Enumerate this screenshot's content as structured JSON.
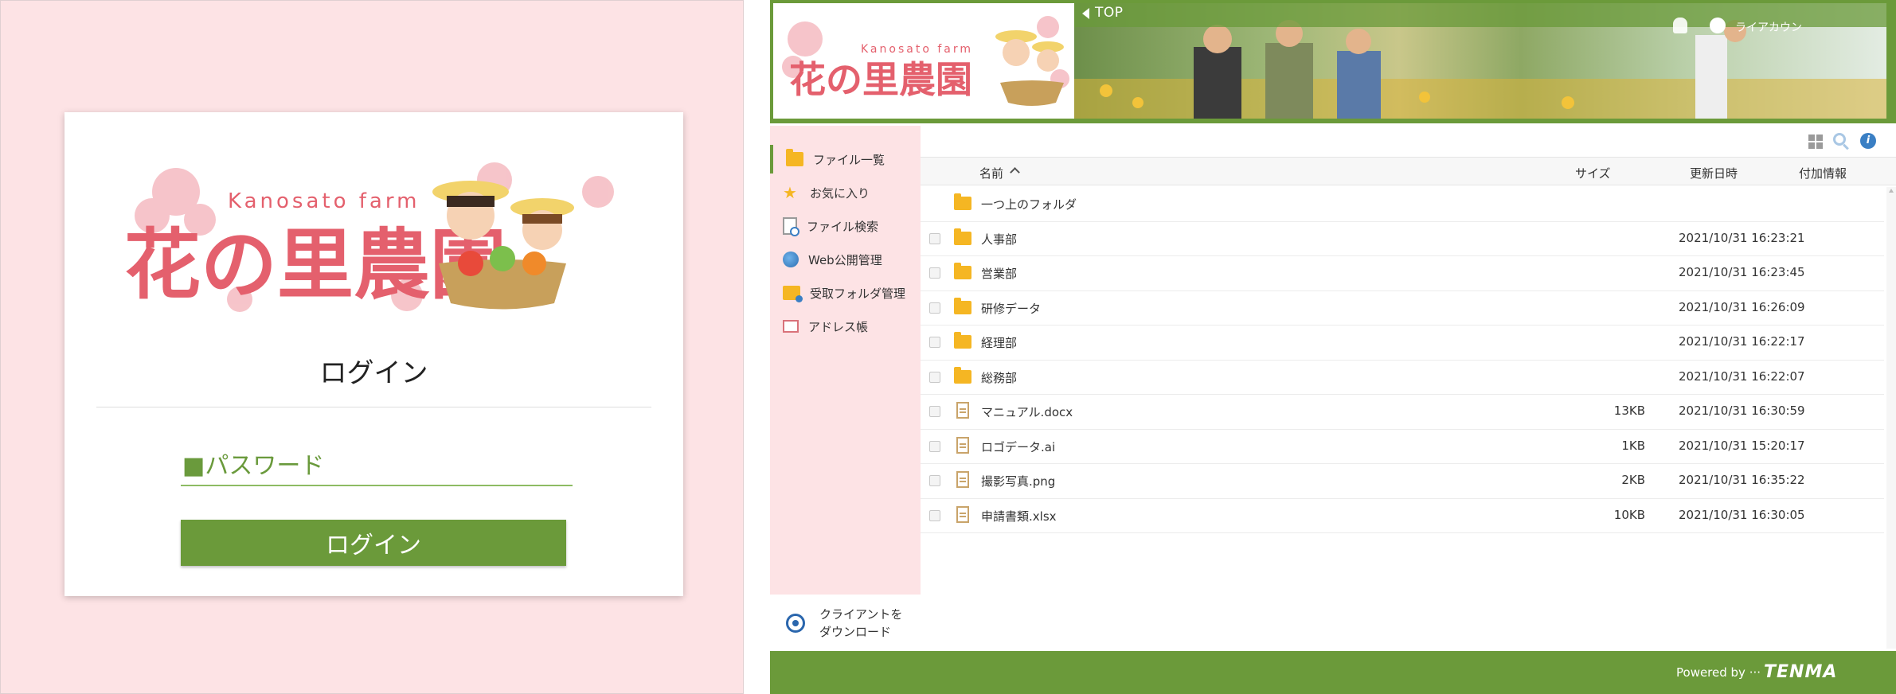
{
  "login": {
    "logo_text_en": "Kanosato farm",
    "logo_text_jp": "花の里農園",
    "title": "ログイン",
    "password_placeholder": "■パスワード",
    "login_button": "ログイン"
  },
  "header": {
    "logo_text_en": "Kanosato farm",
    "logo_text_jp": "花の里農園",
    "top_link": "TOP",
    "user_name": "ライアカウン"
  },
  "sidebar": {
    "items": [
      {
        "label": "ファイル一覧",
        "icon": "folder-icon"
      },
      {
        "label": "お気に入り",
        "icon": "star-icon"
      },
      {
        "label": "ファイル検索",
        "icon": "file-search-icon"
      },
      {
        "label": "Web公開管理",
        "icon": "globe-icon"
      },
      {
        "label": "受取フォルダ管理",
        "icon": "inbox-folder-icon"
      },
      {
        "label": "アドレス帳",
        "icon": "address-book-icon"
      }
    ],
    "client_download": "クライアントを\nダウンロード"
  },
  "table": {
    "columns": {
      "name": "名前",
      "size": "サイズ",
      "date": "更新日時",
      "extra": "付加情報"
    },
    "rows": [
      {
        "type": "parent",
        "name": "一つ上のフォルダ",
        "size": "",
        "date": ""
      },
      {
        "type": "folder",
        "name": "人事部",
        "size": "",
        "date": "2021/10/31 16:23:21"
      },
      {
        "type": "folder",
        "name": "営業部",
        "size": "",
        "date": "2021/10/31 16:23:45"
      },
      {
        "type": "folder",
        "name": "研修データ",
        "size": "",
        "date": "2021/10/31 16:26:09"
      },
      {
        "type": "folder",
        "name": "経理部",
        "size": "",
        "date": "2021/10/31 16:22:17"
      },
      {
        "type": "folder",
        "name": "総務部",
        "size": "",
        "date": "2021/10/31 16:22:07"
      },
      {
        "type": "file",
        "name": "マニュアル.docx",
        "size": "13KB",
        "date": "2021/10/31 16:30:59"
      },
      {
        "type": "file",
        "name": "ロゴデータ.ai",
        "size": "1KB",
        "date": "2021/10/31 15:20:17"
      },
      {
        "type": "file",
        "name": "撮影写真.png",
        "size": "2KB",
        "date": "2021/10/31 16:35:22"
      },
      {
        "type": "file",
        "name": "申請書類.xlsx",
        "size": "10KB",
        "date": "2021/10/31 16:30:05"
      }
    ]
  },
  "footer": {
    "powered_by": "Powered by ···",
    "brand": "TENMA"
  },
  "colors": {
    "brand_green": "#6b9a3a",
    "pink_bg": "#fde3e5",
    "logo_pink": "#e4606d",
    "folder_yellow": "#f5b623"
  }
}
